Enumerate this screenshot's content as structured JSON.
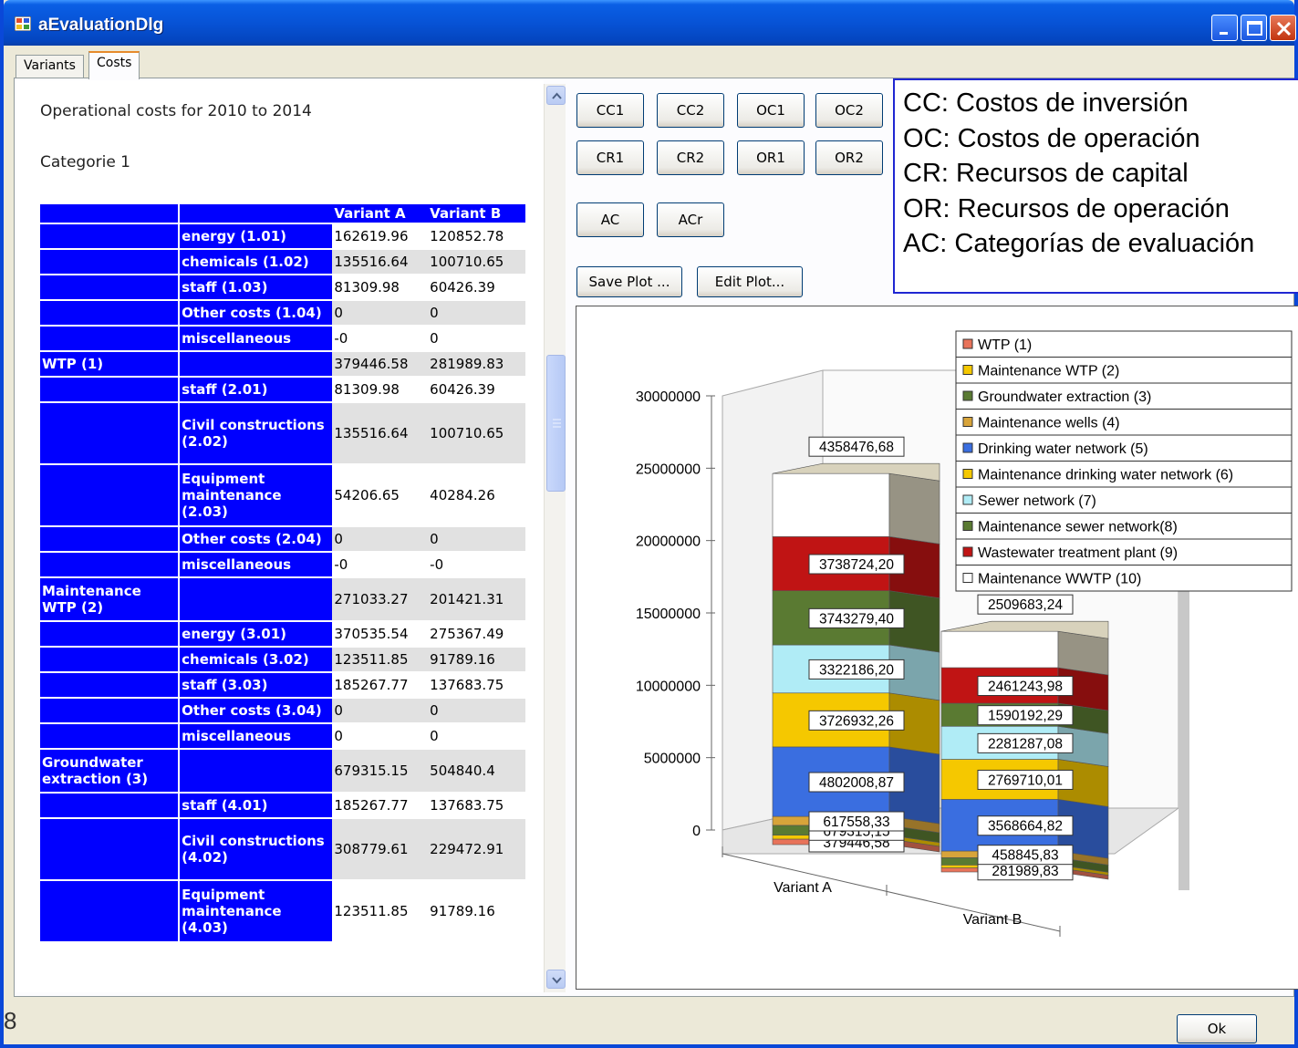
{
  "window": {
    "title": "aEvaluationDlg"
  },
  "tabs": [
    {
      "label": "Variants",
      "active": false
    },
    {
      "label": "Costs",
      "active": true
    }
  ],
  "heading": "Operational costs for 2010 to 2014",
  "category": "Categorie 1",
  "table": {
    "headers": [
      "",
      "",
      "Variant A",
      "Variant B"
    ],
    "rows": [
      {
        "group": "",
        "item": "energy (1.01)",
        "a": "162619.96",
        "b": "120852.78"
      },
      {
        "group": "",
        "item": "chemicals (1.02)",
        "a": "135516.64",
        "b": "100710.65"
      },
      {
        "group": "",
        "item": "staff (1.03)",
        "a": "81309.98",
        "b": "60426.39"
      },
      {
        "group": "",
        "item": "Other costs (1.04)",
        "a": "0",
        "b": "0"
      },
      {
        "group": "",
        "item": "miscellaneous",
        "a": "-0",
        "b": "0"
      },
      {
        "group": "WTP (1)",
        "item": "",
        "a": "379446.58",
        "b": "281989.83"
      },
      {
        "group": "",
        "item": "staff (2.01)",
        "a": "81309.98",
        "b": "60426.39"
      },
      {
        "group": "",
        "item": "Civil constructions (2.02)",
        "a": "135516.64",
        "b": "100710.65"
      },
      {
        "group": "",
        "item": "Equipment maintenance (2.03)",
        "a": "54206.65",
        "b": "40284.26"
      },
      {
        "group": "",
        "item": "Other costs (2.04)",
        "a": "0",
        "b": "0"
      },
      {
        "group": "",
        "item": "miscellaneous",
        "a": "-0",
        "b": "-0"
      },
      {
        "group": "Maintenance WTP (2)",
        "item": "",
        "a": "271033.27",
        "b": "201421.31"
      },
      {
        "group": "",
        "item": "energy (3.01)",
        "a": "370535.54",
        "b": "275367.49"
      },
      {
        "group": "",
        "item": "chemicals (3.02)",
        "a": "123511.85",
        "b": "91789.16"
      },
      {
        "group": "",
        "item": "staff (3.03)",
        "a": "185267.77",
        "b": "137683.75"
      },
      {
        "group": "",
        "item": "Other costs (3.04)",
        "a": "0",
        "b": "0"
      },
      {
        "group": "",
        "item": "miscellaneous",
        "a": "0",
        "b": "0"
      },
      {
        "group": "Groundwater extraction (3)",
        "item": "",
        "a": "679315.15",
        "b": "504840.4"
      },
      {
        "group": "",
        "item": "staff (4.01)",
        "a": "185267.77",
        "b": "137683.75"
      },
      {
        "group": "",
        "item": "Civil constructions (4.02)",
        "a": "308779.61",
        "b": "229472.91"
      },
      {
        "group": "",
        "item": "Equipment maintenance (4.03)",
        "a": "123511.85",
        "b": "91789.16"
      }
    ]
  },
  "buttons": {
    "row1": [
      "CC1",
      "CC2",
      "OC1",
      "OC2"
    ],
    "row2": [
      "CR1",
      "CR2",
      "OR1",
      "OR2"
    ],
    "row3": [
      "AC",
      "ACr"
    ],
    "save_plot": "Save Plot ...",
    "edit_plot": "Edit Plot...",
    "ok": "Ok"
  },
  "abbreviations": [
    "CC: Costos de inversión",
    "OC: Costos de operación",
    "CR: Recursos de capital",
    "OR: Recursos de operación",
    "AC: Categorías de evaluación"
  ],
  "page_number": "8",
  "chart_data": {
    "type": "bar",
    "stacked": true,
    "three_d": true,
    "categories": [
      "Variant A",
      "Variant B"
    ],
    "ylim": [
      0,
      30000000
    ],
    "yticks": [
      "0",
      "5000000",
      "10000000",
      "15000000",
      "20000000",
      "25000000",
      "30000000"
    ],
    "legend_position": "top-right",
    "series": [
      {
        "name": "WTP (1)",
        "color": "#e8735a",
        "values": [
          379446.58,
          281989.83
        ],
        "labels": [
          "379446,58",
          "281989,83"
        ]
      },
      {
        "name": "Maintenance WTP (2)",
        "color": "#f5c800",
        "values": [
          271033.27,
          201421.31
        ],
        "labels": [
          "",
          ""
        ]
      },
      {
        "name": "Groundwater extraction (3)",
        "color": "#5a7a32",
        "values": [
          679315.15,
          504840.4
        ],
        "labels": [
          "679315,15",
          ""
        ]
      },
      {
        "name": "Maintenance wells (4)",
        "color": "#d8a43a",
        "values": [
          617558.33,
          458845.83
        ],
        "labels": [
          "617558,33",
          "458845,83"
        ]
      },
      {
        "name": "Drinking water network (5)",
        "color": "#3a6ee0",
        "values": [
          4802008.87,
          3568664.82
        ],
        "labels": [
          "4802008,87",
          "3568664,82"
        ]
      },
      {
        "name": "Maintenance drinking water network (6)",
        "color": "#f5c800",
        "values": [
          3726932.26,
          2769710.01
        ],
        "labels": [
          "3726932,26",
          "2769710,01"
        ]
      },
      {
        "name": "Sewer network (7)",
        "color": "#b0ecf6",
        "values": [
          3322186.2,
          2281287.08
        ],
        "labels": [
          "3322186,20",
          "2281287,08"
        ]
      },
      {
        "name": "Maintenance sewer network(8)",
        "color": "#5a7a32",
        "values": [
          3743279.4,
          1590192.29
        ],
        "labels": [
          "3743279,40",
          "1590192,29"
        ]
      },
      {
        "name": "Wastewater treatment plant (9)",
        "color": "#c01414",
        "values": [
          3738724.2,
          2461243.98
        ],
        "labels": [
          "3738724,20",
          "2461243,98"
        ]
      },
      {
        "name": "Maintenance WWTP (10)",
        "color": "#ffffff",
        "values": [
          4358476.68,
          2509683.24
        ],
        "labels": [
          "4358476,68",
          "2509683,24"
        ]
      }
    ]
  }
}
